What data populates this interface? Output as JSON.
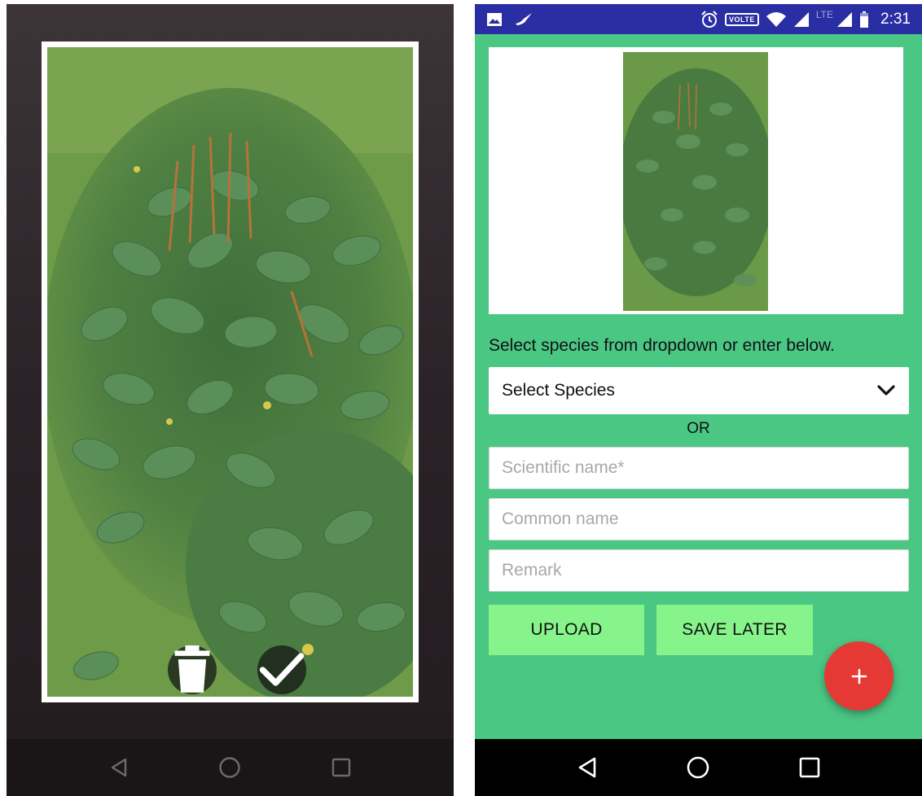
{
  "status_bar": {
    "time": "2:31",
    "volte_label": "VOLTE",
    "network_label": "LTE"
  },
  "form": {
    "instruction": "Select species from dropdown or enter below.",
    "species_dropdown": {
      "selected": "Select Species"
    },
    "or_label": "OR",
    "scientific_name": {
      "value": "",
      "placeholder": "Scientific name*"
    },
    "common_name": {
      "value": "",
      "placeholder": "Common name"
    },
    "remark": {
      "value": "",
      "placeholder": "Remark"
    },
    "upload_label": "UPLOAD",
    "save_later_label": "SAVE LATER",
    "fab_label": "+"
  },
  "icons": {
    "photo_actions": [
      "trash-icon",
      "check-icon"
    ],
    "navigation": [
      "back-icon",
      "home-icon",
      "recents-icon"
    ],
    "status": [
      "gallery-icon",
      "bird-icon",
      "alarm-icon",
      "wifi-icon",
      "signal-icon",
      "battery-icon"
    ]
  },
  "colors": {
    "form_background": "#4bc784",
    "status_bar": "#2a2ea3",
    "button_background": "#86f48a",
    "fab": "#e53935",
    "photo_action_background": "#1e1e1e"
  }
}
